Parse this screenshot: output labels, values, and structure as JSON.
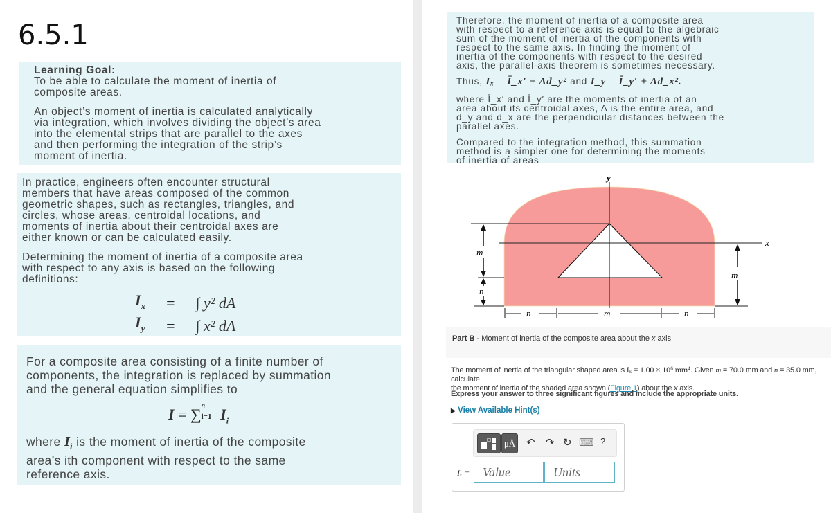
{
  "page_title": "6.5.1",
  "left": {
    "box1": {
      "heading": "Learning Goal:",
      "goal": [
        "To be able to calculate the moment of inertia of",
        "composite areas."
      ],
      "intro": [
        "An object’s moment of inertia is calculated analytically",
        "via integration, which involves dividing the object’s area",
        "into the elemental strips that are parallel to the axes",
        "and then performing the integration of the strip’s",
        "moment of inertia."
      ]
    },
    "box2": {
      "para1": [
        "In practice, engineers often encounter structural",
        "members that have areas composed of the common",
        "geometric shapes, such as rectangles, triangles, and",
        "circles, whose areas, centroidal locations, and",
        "moments of inertia about their centroidal axes are",
        "either known or can be calculated easily."
      ],
      "para2": [
        "Determining the moment of inertia of a composite area",
        "with respect to any axis is based on the following",
        "definitions:"
      ],
      "equations": [
        {
          "lhs": "I",
          "lhs_sub": "x",
          "eq": "=",
          "rhs": "∫ y² dA"
        },
        {
          "lhs": "I",
          "lhs_sub": "y",
          "eq": "=",
          "rhs": "∫ x² dA"
        }
      ]
    },
    "box3": {
      "para1": [
        "For a composite area consisting of a finite number of",
        "components, the integration is replaced by summation",
        "and the general equation simplifies to"
      ],
      "sum_equation": {
        "lhs": "I",
        "eq": "=",
        "sigma": "∑",
        "upper": "n",
        "lower": "i=1",
        "term": "I",
        "term_sub": "i"
      },
      "para2_prefix": "where ",
      "para2_var": "I",
      "para2_var_sub": "i",
      "para2_line1_rest": " is the moment of inertia of the composite",
      "para2_line2": "area’s ith component with respect to the same",
      "para2_line3": "reference axis."
    }
  },
  "right": {
    "box4": {
      "para1": [
        "Therefore, the moment of inertia of a composite area",
        "with respect to a reference axis is equal to the algebraic",
        "sum of the moment of inertia of the components with",
        "respect to the same axis. In finding the moment of",
        "inertia of the components with respect to the desired",
        "axis, the parallel-axis theorem is sometimes necessary."
      ],
      "thus_label": "Thus,",
      "thus_eq1": "Iₓ = Ī_x′ + Ad_y²",
      "thus_and": "and",
      "thus_eq2": "I_y = Ī_y′ + Ad_x².",
      "where_lines": [
        "where Ī_x′ and Ī_y′ are the moments of inertia of an",
        "area about its centroidal axes, A is the entire area, and",
        "d_y and d_x are the perpendicular distances between the",
        "parallel axes."
      ],
      "para3": [
        "Compared to the integration method, this summation",
        "method is a simpler one for determining the moments",
        "of inertia of areas"
      ]
    },
    "figure": {
      "labels": {
        "y_axis": "y",
        "x_axis": "x",
        "m": "m",
        "n": "n"
      },
      "shaded_color": "#f79a9a"
    },
    "part_b": {
      "label": "Part B",
      "separator": " - ",
      "title_prefix": "Moment of inertia of the composite area about the ",
      "title_var": "x",
      "title_suffix": " axis"
    },
    "question": {
      "line1_a": "The moment of inertia of the triangular shaped area is ",
      "Ix_value": "Iₓ = 1.00 × 10⁶ mm⁴",
      "line1_b": ". Given ",
      "m_label": "m",
      "m_value": " = 70.0 mm",
      "and": " and ",
      "n_label": "n",
      "n_value": " = 35.0 mm",
      "line1_c": ", calculate",
      "line2_a": "the moment of inertia of the shaded area shown (",
      "figure_link": "Figure 1",
      "line2_b": ") about the ",
      "line2_var": "x",
      "line2_c": " axis."
    },
    "instructions": "Express your answer to three significant figures and include the appropriate units.",
    "hint_link": "View Available Hint(s)",
    "answer": {
      "label": "Iₓ =",
      "value_placeholder": "Value",
      "units_placeholder": "Units",
      "toolbar": {
        "templates_label": "",
        "units_label": "μÅ",
        "undo": "↶",
        "redo": "↷",
        "reset": "↻",
        "keyboard": "⌨",
        "help": "?"
      }
    }
  }
}
